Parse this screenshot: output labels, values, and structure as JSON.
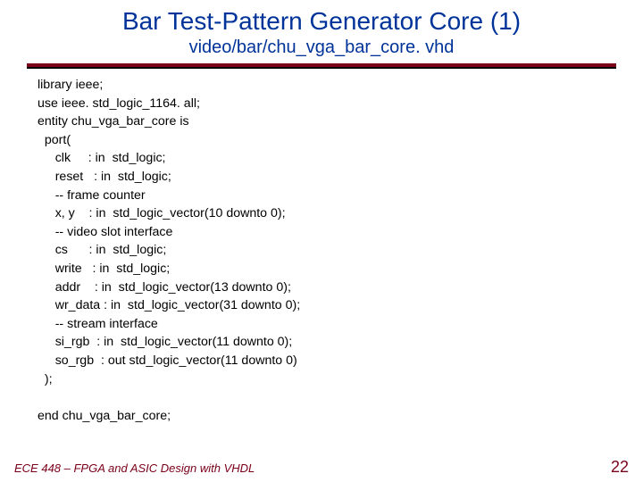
{
  "title": "Bar Test-Pattern Generator Core (1)",
  "subtitle": "video/bar/chu_vga_bar_core. vhd",
  "code_lines": [
    "library ieee;",
    "use ieee. std_logic_1164. all;",
    "entity chu_vga_bar_core is",
    "  port(",
    "     clk     : in  std_logic;",
    "     reset   : in  std_logic;",
    "     -- frame counter",
    "     x, y    : in  std_logic_vector(10 downto 0);",
    "     -- video slot interface",
    "     cs      : in  std_logic;",
    "     write   : in  std_logic;",
    "     addr    : in  std_logic_vector(13 downto 0);",
    "     wr_data : in  std_logic_vector(31 downto 0);",
    "     -- stream interface",
    "     si_rgb  : in  std_logic_vector(11 downto 0);",
    "     so_rgb  : out std_logic_vector(11 downto 0)",
    "  );",
    "",
    "end chu_vga_bar_core;"
  ],
  "footer_left": "ECE 448 – FPGA and ASIC Design with VHDL",
  "footer_right": "22"
}
